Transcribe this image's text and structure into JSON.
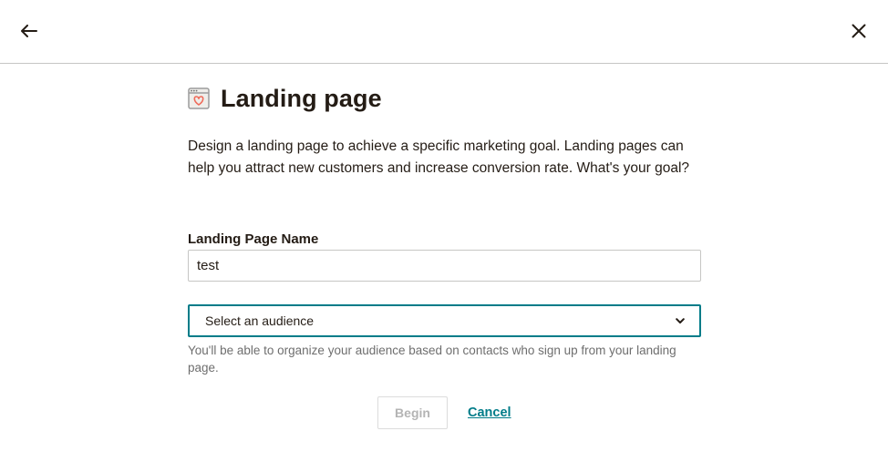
{
  "header": {
    "back_icon": "arrow-left-icon",
    "close_icon": "close-icon"
  },
  "main": {
    "icon": "landing-page-heart-icon",
    "title": "Landing page",
    "description": "Design a landing page to achieve a specific marketing goal. Landing pages can help you attract new customers and increase conversion rate. What's your goal?",
    "name_field": {
      "label": "Landing Page Name",
      "value": "test",
      "placeholder": ""
    },
    "audience_select": {
      "selected": "Select an audience",
      "icon": "chevron-down-icon"
    },
    "helper_text": "You'll be able to organize your audience based on contacts who sign up from your landing page.",
    "actions": {
      "begin_label": "Begin",
      "cancel_label": "Cancel"
    }
  },
  "colors": {
    "accent": "#007c89",
    "text": "#241c15",
    "muted": "#6e6e6e",
    "icon_heart": "#ef6b5a"
  }
}
